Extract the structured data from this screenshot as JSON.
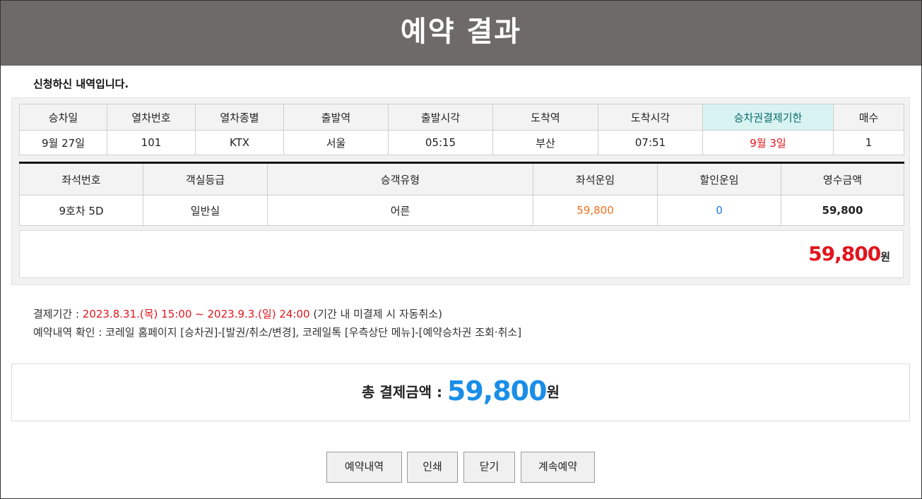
{
  "page": {
    "title": "예약 결과",
    "intro": "신청하신 내역입니다."
  },
  "schedule": {
    "headers": [
      "승차일",
      "열차번호",
      "열차종별",
      "출발역",
      "출발시각",
      "도착역",
      "도착시각",
      "승차권결제기한",
      "매수"
    ],
    "row": [
      "9월 27일",
      "101",
      "KTX",
      "서울",
      "05:15",
      "부산",
      "07:51",
      "9월 3일",
      "1"
    ]
  },
  "fare": {
    "headers": [
      "좌석번호",
      "객실등급",
      "승객유형",
      "좌석운임",
      "할인운임",
      "영수금액"
    ],
    "row": [
      "9호차 5D",
      "일반실",
      "어른",
      "59,800",
      "0",
      "59,800"
    ]
  },
  "subtotal": {
    "amount": "59,800",
    "unit": "원"
  },
  "payment_period": {
    "label": "결제기간 : ",
    "range": "2023.8.31.(목) 15:00  ~ 2023.9.3.(일) 24:00",
    "note": " (기간 내 미결제 시 자동취소)"
  },
  "confirm_info": "예약내역 확인 : 코레일 홈페이지 [승차권]-[발권/취소/변경], 코레일톡 [우측상단 메뉴]-[예약승차권 조회·취소]",
  "total": {
    "label": "총 결제금액 : ",
    "amount": "59,800",
    "unit": "원"
  },
  "buttons": {
    "history": "예약내역",
    "print": "인쇄",
    "close": "닫기",
    "continue": "계속예약"
  },
  "colors": {
    "title_bg": "#6e6a6a",
    "red": "#e2151d",
    "blue": "#1a8ee8",
    "orange": "#f0701e",
    "deadline_header_bg": "#d9f3f3"
  }
}
